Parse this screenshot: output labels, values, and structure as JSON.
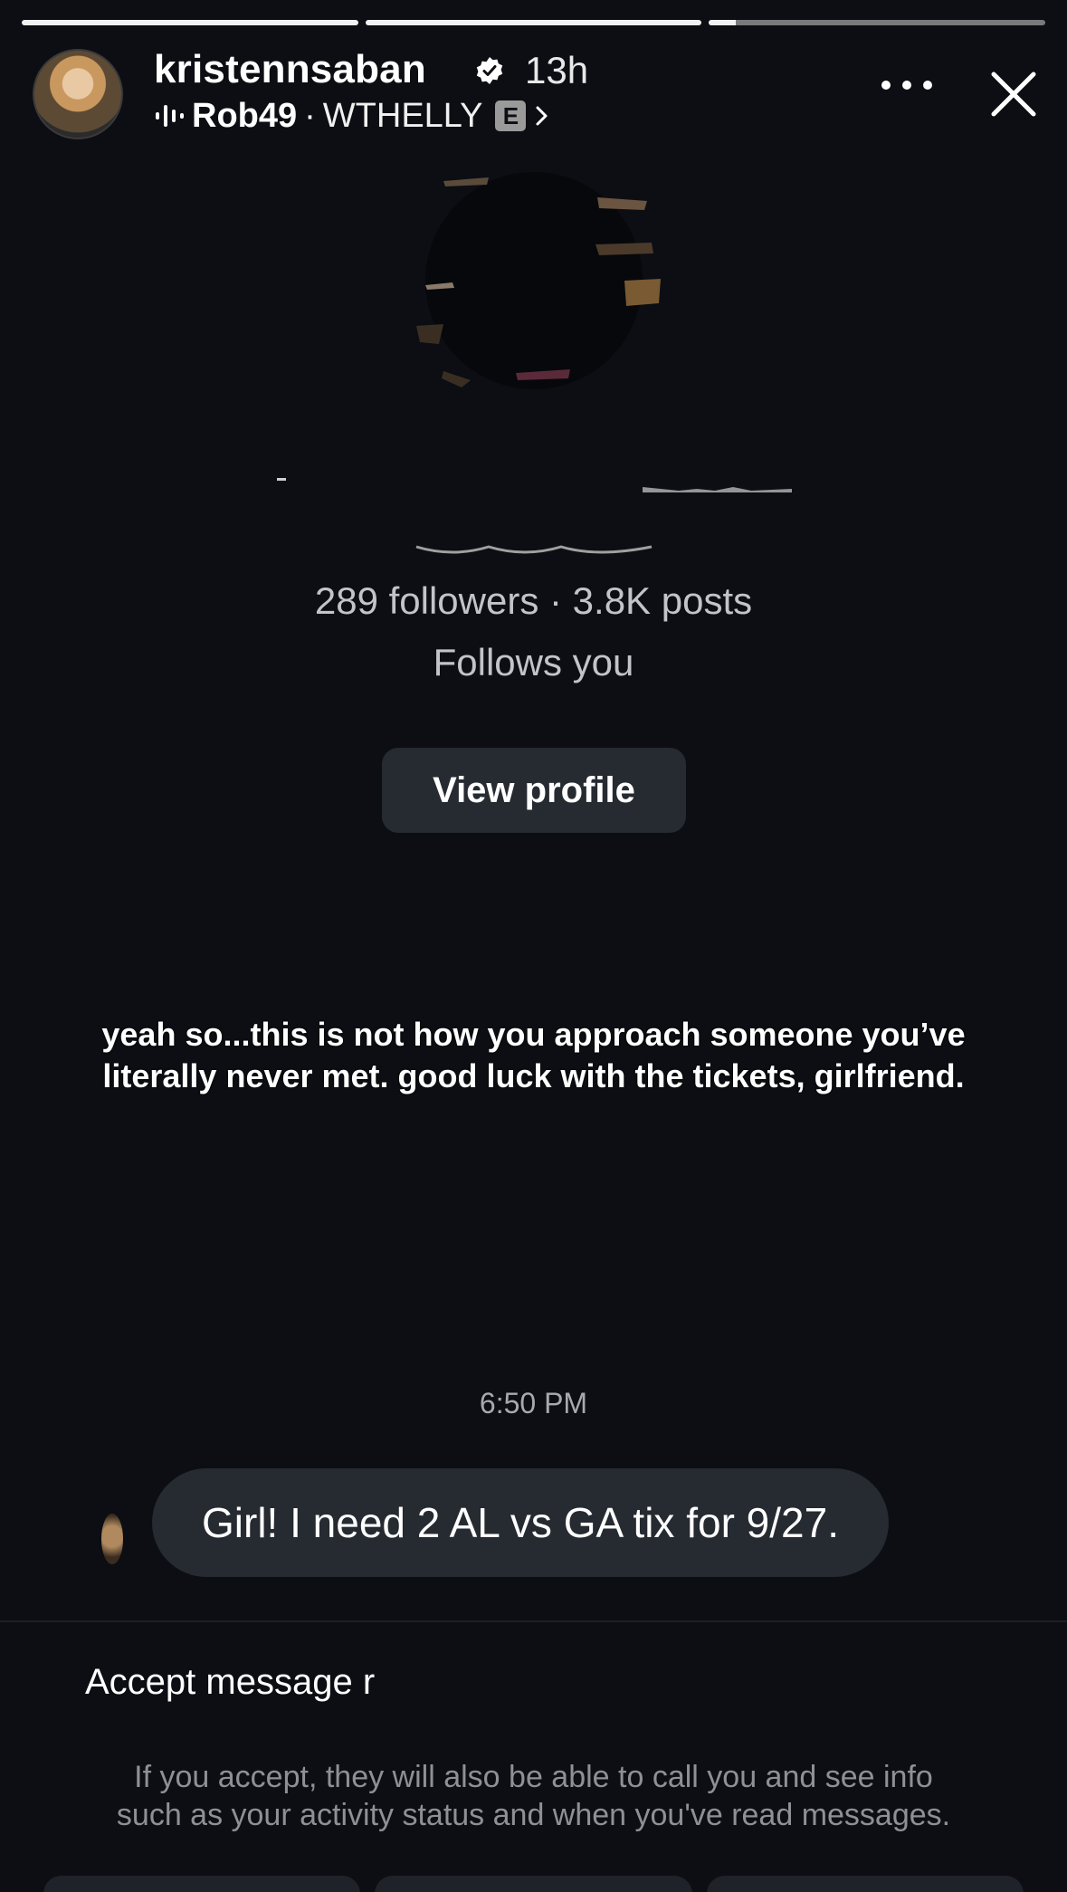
{
  "story": {
    "progress": [
      1,
      1,
      0.08
    ]
  },
  "header": {
    "username": "kristennsaban",
    "time": "13h",
    "music": {
      "artist": "Rob49",
      "separator": "·",
      "song": "WTHELLY",
      "explicit_badge": "E"
    },
    "icons": {
      "verified": "verified-badge-icon",
      "audio": "audio-wave-icon",
      "more": "more-icon",
      "close": "close-icon",
      "chevron": "chevron-right-icon"
    }
  },
  "profile": {
    "stats": "289 followers · 3.8K posts",
    "follows_you": "Follows you",
    "view_profile_label": "View profile"
  },
  "caption": {
    "line1": "yeah so...this is not how you approach someone you’ve",
    "line2": "literally never met. good luck with the tickets, girlfriend."
  },
  "chat": {
    "timestamp": "6:50 PM",
    "message": "Girl! I need 2 AL vs GA tix for 9/27."
  },
  "request": {
    "title": "Accept message r",
    "info_line1": "If you accept, they will also be able to call you and see info",
    "info_line2": "such as your activity status and when you've read messages."
  },
  "colors": {
    "background": "#0c0e13",
    "button": "#262a31",
    "muted_text": "#c2c4c8",
    "info_text": "#8d9096"
  }
}
